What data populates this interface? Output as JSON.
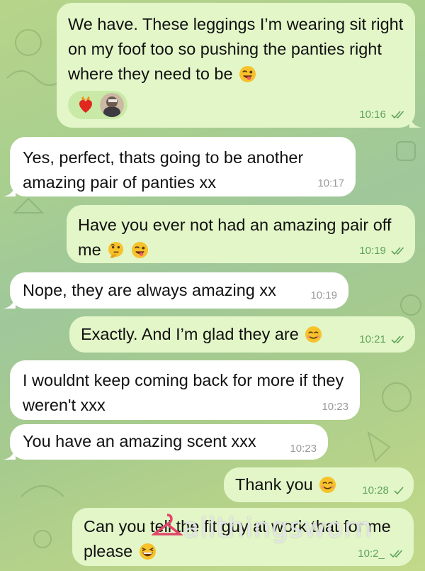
{
  "messages": [
    {
      "direction": "outgoing",
      "text": "We have. These leggings I’m wearing sit right on my foof too so pushing the panties right where they need to be",
      "emojis": [
        "winking-face-with-tongue"
      ],
      "reactions": [
        "heart-on-fire",
        "user-avatar"
      ],
      "time": "10:16",
      "status": "read"
    },
    {
      "direction": "incoming",
      "text": "Yes, perfect, thats going to be another amazing pair of panties xx",
      "time": "10:17"
    },
    {
      "direction": "outgoing",
      "text": "Have you ever not had an amazing pair off me",
      "emojis": [
        "thinking-face",
        "winking-face-with-tongue"
      ],
      "time": "10:19",
      "status": "read"
    },
    {
      "direction": "incoming",
      "text": "Nope, they are always amazing xx",
      "time": "10:19"
    },
    {
      "direction": "outgoing",
      "text": "Exactly. And I’m glad they are",
      "emojis": [
        "smiling-face"
      ],
      "time": "10:21",
      "status": "read"
    },
    {
      "direction": "incoming",
      "text": "I wouldnt keep coming back for more if they weren't xxx",
      "time": "10:23"
    },
    {
      "direction": "incoming",
      "text": "You have an amazing scent xxx",
      "time": "10:23"
    },
    {
      "direction": "outgoing",
      "text": "Thank you",
      "emojis": [
        "smiling-face"
      ],
      "time": "10:28",
      "status": "delivered"
    },
    {
      "direction": "outgoing",
      "text": "Can you tell the fit guy at work that for me please",
      "emojis": [
        "grinning-squinting-face"
      ],
      "time": "10:2_",
      "status": "read"
    }
  ],
  "watermark": "allthingsworn",
  "colors": {
    "outgoing_bubble": "#e3f6c8",
    "incoming_bubble": "#ffffff",
    "outgoing_time": "#5fa35a",
    "incoming_time": "#9a9a9a",
    "background": "#a9cf8f"
  }
}
